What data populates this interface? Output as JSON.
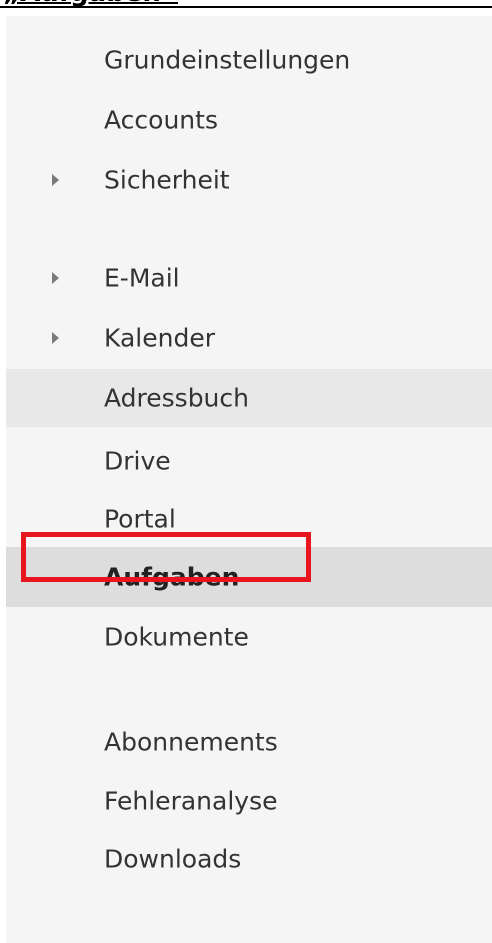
{
  "heading": {
    "text": "„Aufgaben“"
  },
  "sidebar": {
    "items": [
      {
        "label": "Grundeinstellungen",
        "expandable": false,
        "state": "normal"
      },
      {
        "label": "Accounts",
        "expandable": false,
        "state": "normal"
      },
      {
        "label": "Sicherheit",
        "expandable": true,
        "state": "normal"
      },
      {
        "label": "E-Mail",
        "expandable": true,
        "state": "normal"
      },
      {
        "label": "Kalender",
        "expandable": true,
        "state": "normal"
      },
      {
        "label": "Adressbuch",
        "expandable": false,
        "state": "hover"
      },
      {
        "label": "Drive",
        "expandable": false,
        "state": "normal"
      },
      {
        "label": "Portal",
        "expandable": false,
        "state": "normal"
      },
      {
        "label": "Aufgaben",
        "expandable": false,
        "state": "selected"
      },
      {
        "label": "Dokumente",
        "expandable": false,
        "state": "normal"
      },
      {
        "label": "Abonnements",
        "expandable": false,
        "state": "normal"
      },
      {
        "label": "Fehleranalyse",
        "expandable": false,
        "state": "normal"
      },
      {
        "label": "Downloads",
        "expandable": false,
        "state": "normal"
      }
    ]
  },
  "colors": {
    "sidebar_bg": "#f5f5f5",
    "hover_bg": "#e8e8e8",
    "selected_bg": "#dddddd",
    "highlight_border": "#e8151f",
    "caret": "#7a7a7a",
    "text": "#333333"
  }
}
